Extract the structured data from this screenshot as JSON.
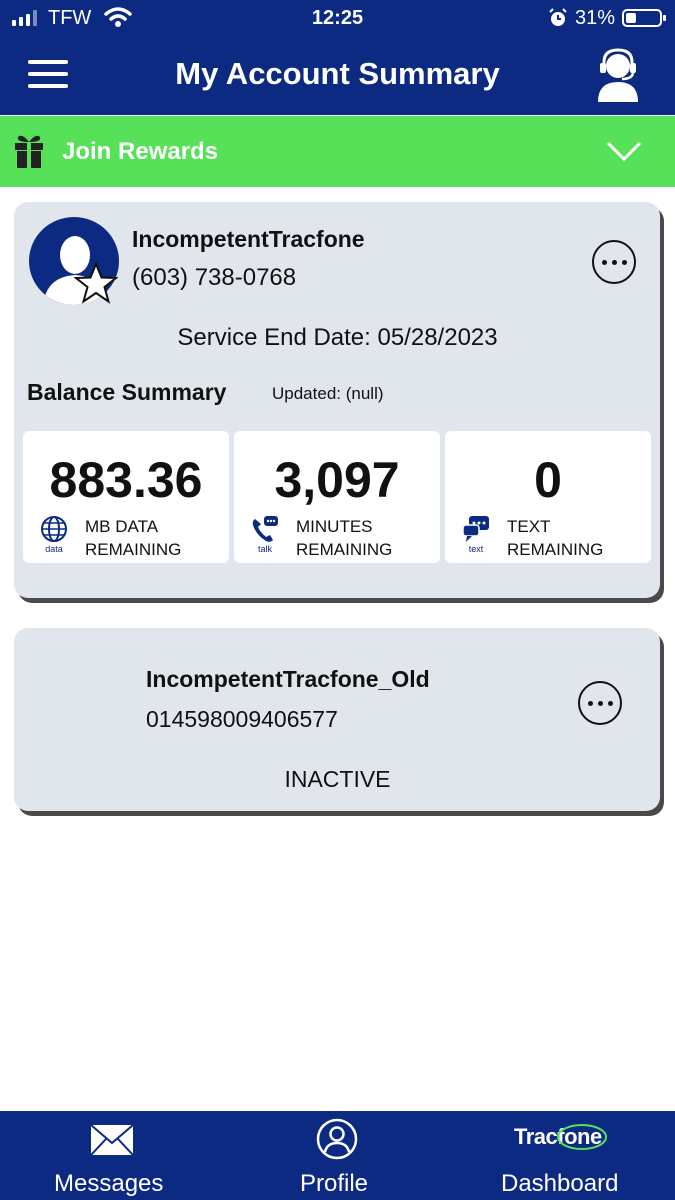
{
  "status_bar": {
    "carrier": "TFW",
    "time": "12:25",
    "battery": "31%"
  },
  "header": {
    "title": "My Account Summary"
  },
  "rewards": {
    "label": "Join Rewards"
  },
  "account": {
    "name": "IncompetentTracfone",
    "phone": "(603) 738-0768",
    "service_end": "Service End Date: 05/28/2023",
    "balance_title": "Balance Summary",
    "updated": "Updated: (null)",
    "tiles": [
      {
        "value": "883.36",
        "icon_caption": "data",
        "label_line1": "MB DATA",
        "label_line2": "REMAINING"
      },
      {
        "value": "3,097",
        "icon_caption": "talk",
        "label_line1": "MINUTES",
        "label_line2": "REMAINING"
      },
      {
        "value": "0",
        "icon_caption": "text",
        "label_line1": "TEXT",
        "label_line2": "REMAINING"
      }
    ]
  },
  "old_account": {
    "name": "IncompetentTracfone_Old",
    "id": "014598009406577",
    "status": "INACTIVE"
  },
  "bottom_nav": {
    "brand": "Tracfone",
    "items": [
      {
        "label": "Messages",
        "icon": "envelope-icon"
      },
      {
        "label": "Profile",
        "icon": "person-circle-icon"
      },
      {
        "label": "Dashboard",
        "icon": "tracfone-logo"
      }
    ]
  },
  "colors": {
    "brand_blue": "#0d2a82",
    "rewards_green": "#57e158",
    "card_bg": "#e1e6ed"
  }
}
